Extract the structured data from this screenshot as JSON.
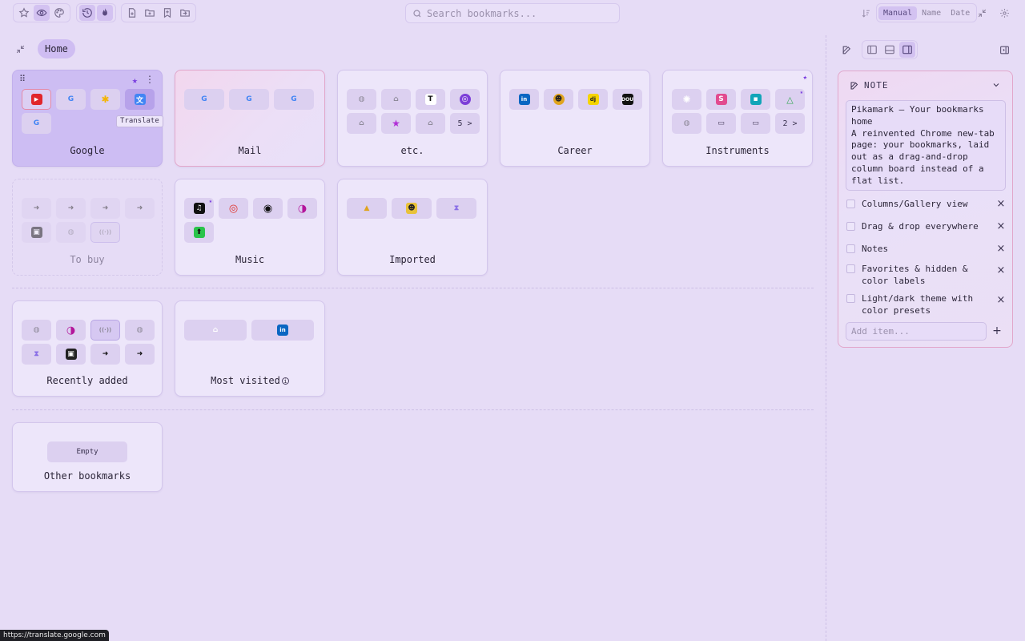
{
  "search": {
    "placeholder": "Search bookmarks..."
  },
  "sort": {
    "manual": "Manual",
    "name": "Name",
    "date": "Date"
  },
  "breadcrumb": {
    "home": "Home"
  },
  "cards": {
    "google": {
      "title": "Google",
      "tooltip": "Translate"
    },
    "mail": {
      "title": "Mail"
    },
    "etc": {
      "title": "etc.",
      "more": "5 >"
    },
    "career": {
      "title": "Career"
    },
    "instruments": {
      "title": "Instruments",
      "more": "2 >"
    },
    "tobuy": {
      "title": "To buy"
    },
    "music": {
      "title": "Music"
    },
    "imported": {
      "title": "Imported"
    },
    "recent": {
      "title": "Recently added"
    },
    "visited": {
      "title": "Most visited"
    },
    "other": {
      "title": "Other bookmarks",
      "empty": "Empty"
    }
  },
  "icon_glyphs": {
    "youtube": "▶",
    "google": "G",
    "translate": "文",
    "github": "⌂",
    "tiktok": "T",
    "tor": "◎",
    "star": "★",
    "linkedin": "in",
    "djinni": "dj",
    "dou": "DOU",
    "folder": "▭",
    "arrow": "➜",
    "stack": "◑",
    "hourglass": "⧗",
    "music_mark": "◉",
    "upload": "⬆",
    "chip": "▣",
    "globe": "◍",
    "drive": "△",
    "app_sq": "▪",
    "wave": "((·))"
  },
  "note": {
    "header": "NOTE",
    "text": "Pikamark — Your bookmarks home\nA reinvented Chrome new-tab page: your bookmarks, laid out as a drag-and-drop column board instead of a flat list.",
    "items": [
      "Columns/Gallery view",
      "Drag & drop everywhere",
      "Notes",
      "Favorites & hidden & color labels",
      "Light/dark theme with color presets"
    ],
    "add_placeholder": "Add item...",
    "remove": "×",
    "add": "+"
  },
  "status_url": "https://translate.google.com",
  "colors": {
    "background": "#e6dcf6",
    "accent": "#7a3ee0",
    "selected_card": "#cdbdf3",
    "pink_border": "#e2a7cb"
  }
}
